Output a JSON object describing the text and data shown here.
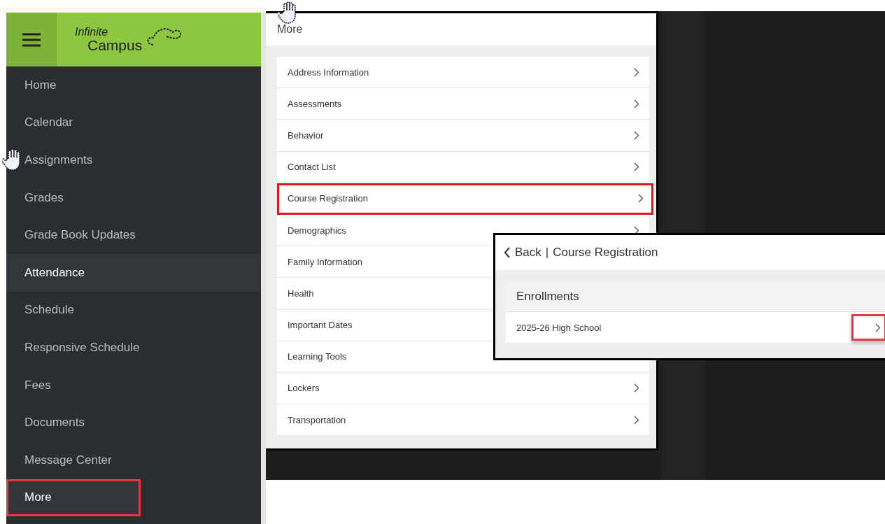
{
  "sidebar": {
    "logo": {
      "line_1": "Infinite",
      "line_2": "Campus"
    },
    "items": [
      {
        "label": "Home",
        "emphasized": false,
        "highlighted": false
      },
      {
        "label": "Calendar",
        "emphasized": false,
        "highlighted": false
      },
      {
        "label": "Assignments",
        "emphasized": false,
        "highlighted": false
      },
      {
        "label": "Grades",
        "emphasized": false,
        "highlighted": false
      },
      {
        "label": "Grade Book Updates",
        "emphasized": false,
        "highlighted": false
      },
      {
        "label": "Attendance",
        "emphasized": true,
        "highlighted": false
      },
      {
        "label": "Schedule",
        "emphasized": false,
        "highlighted": false
      },
      {
        "label": "Responsive Schedule",
        "emphasized": false,
        "highlighted": false
      },
      {
        "label": "Fees",
        "emphasized": false,
        "highlighted": false
      },
      {
        "label": "Documents",
        "emphasized": false,
        "highlighted": false
      },
      {
        "label": "Message Center",
        "emphasized": false,
        "highlighted": false
      },
      {
        "label": "More",
        "emphasized": true,
        "highlighted": true
      }
    ]
  },
  "more_panel": {
    "title": "More",
    "items": [
      {
        "label": "Address Information",
        "highlighted": false,
        "chevron": true
      },
      {
        "label": "Assessments",
        "highlighted": false,
        "chevron": true
      },
      {
        "label": "Behavior",
        "highlighted": false,
        "chevron": true
      },
      {
        "label": "Contact List",
        "highlighted": false,
        "chevron": true
      },
      {
        "label": "Course Registration",
        "highlighted": true,
        "chevron": true
      },
      {
        "label": "Demographics",
        "highlighted": false,
        "chevron": true
      },
      {
        "label": "Family Information",
        "highlighted": false
      },
      {
        "label": "Health",
        "highlighted": false
      },
      {
        "label": "Important Dates",
        "highlighted": false
      },
      {
        "label": "Learning Tools",
        "highlighted": false
      },
      {
        "label": "Lockers",
        "highlighted": false,
        "chevron": true
      },
      {
        "label": "Transportation",
        "highlighted": false,
        "chevron": true
      }
    ]
  },
  "course_panel": {
    "back": "Back",
    "separator": "|",
    "title": "Course Registration",
    "section": "Enrollments",
    "items": [
      {
        "label": "2025-26 High School",
        "chevron_highlighted": true
      }
    ]
  }
}
